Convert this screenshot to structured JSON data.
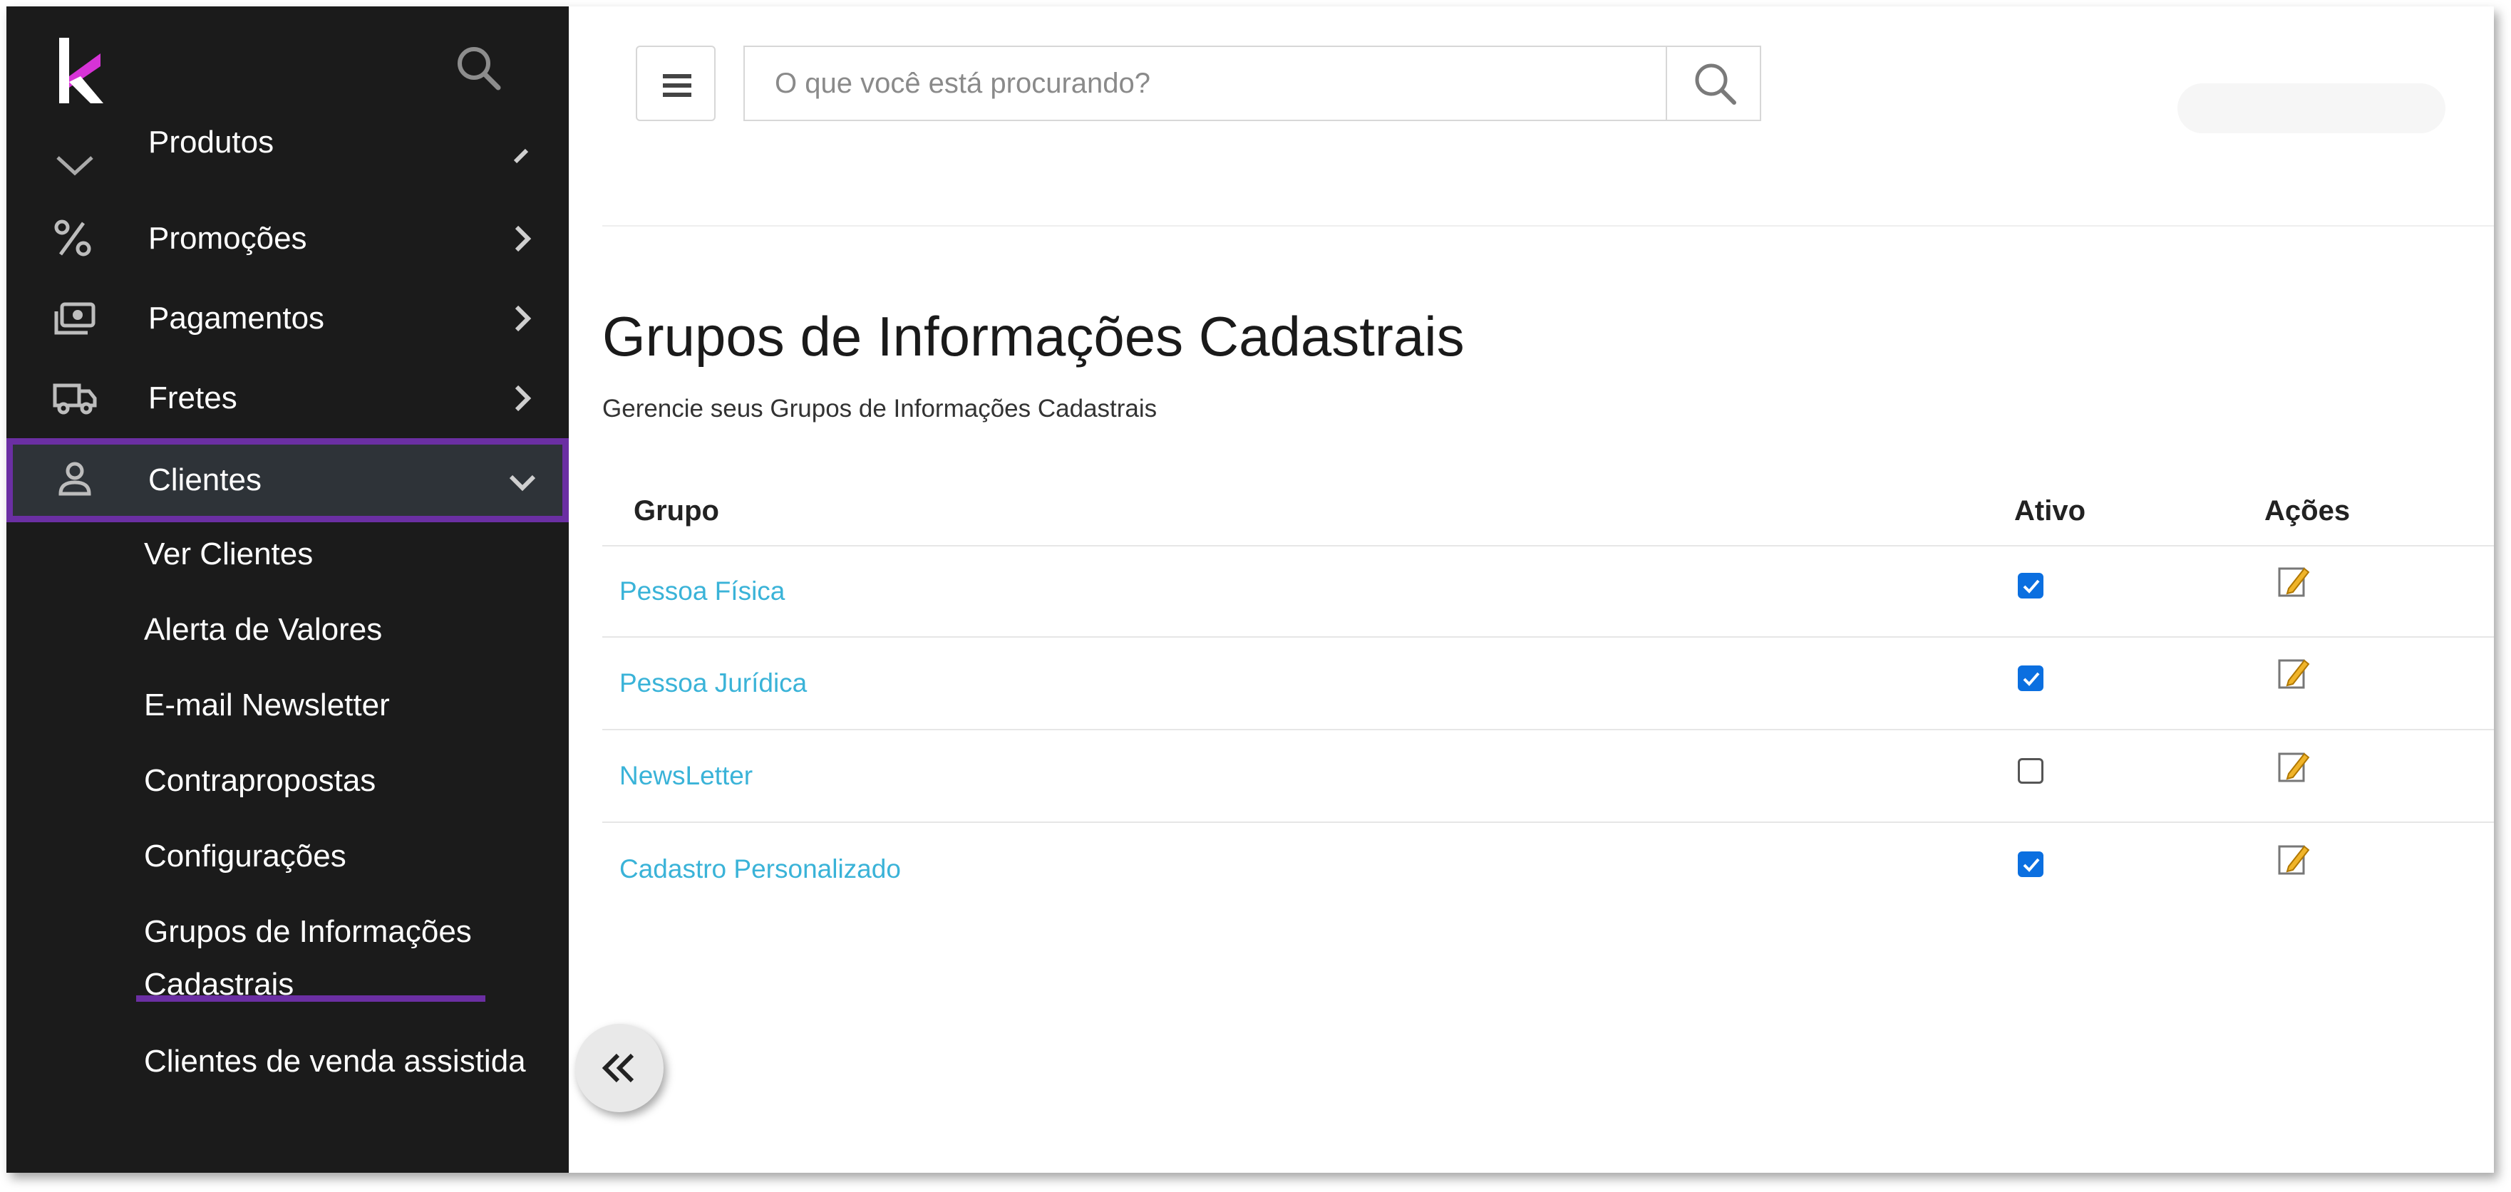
{
  "brand": {
    "logo_icon": "brand-k-logo-icon",
    "accent": "#d633d6",
    "active_border": "#6b2fa3"
  },
  "sidebar": {
    "search_icon": "search-icon",
    "items": [
      {
        "label": "Produtos",
        "icon": "chevron-down-icon",
        "chevron": "chevron-right-icon"
      },
      {
        "label": "Promoções",
        "icon": "percent-icon",
        "chevron": "chevron-right-icon"
      },
      {
        "label": "Pagamentos",
        "icon": "money-icon",
        "chevron": "chevron-right-icon"
      },
      {
        "label": "Fretes",
        "icon": "truck-icon",
        "chevron": "chevron-right-icon"
      },
      {
        "label": "Clientes",
        "icon": "user-icon",
        "chevron": "chevron-down-icon",
        "active": true
      }
    ],
    "sub_items": [
      "Ver Clientes",
      "Alerta de Valores",
      "E-mail Newsletter",
      "Contrapropostas",
      "Configurações",
      "Grupos de Informações",
      "Cadastrais",
      "Clientes de venda assistida"
    ],
    "collapse_icon": "double-chevron-left-icon"
  },
  "header": {
    "menu_icon": "hamburger-menu-icon",
    "search_placeholder": "O que você está procurando?",
    "search_value": ""
  },
  "page": {
    "title": "Grupos de Informações Cadastrais",
    "subtitle": "Gerencie seus Grupos de Informações Cadastrais"
  },
  "table": {
    "columns": [
      "Grupo",
      "Ativo",
      "Ações"
    ],
    "rows": [
      {
        "grupo": "Pessoa Física",
        "ativo": true
      },
      {
        "grupo": "Pessoa Jurídica",
        "ativo": true
      },
      {
        "grupo": "NewsLetter",
        "ativo": false
      },
      {
        "grupo": "Cadastro Personalizado",
        "ativo": true
      }
    ],
    "action_icon": "edit-icon",
    "link_color": "#3ab3d8",
    "check_color": "#0b6fe0"
  }
}
